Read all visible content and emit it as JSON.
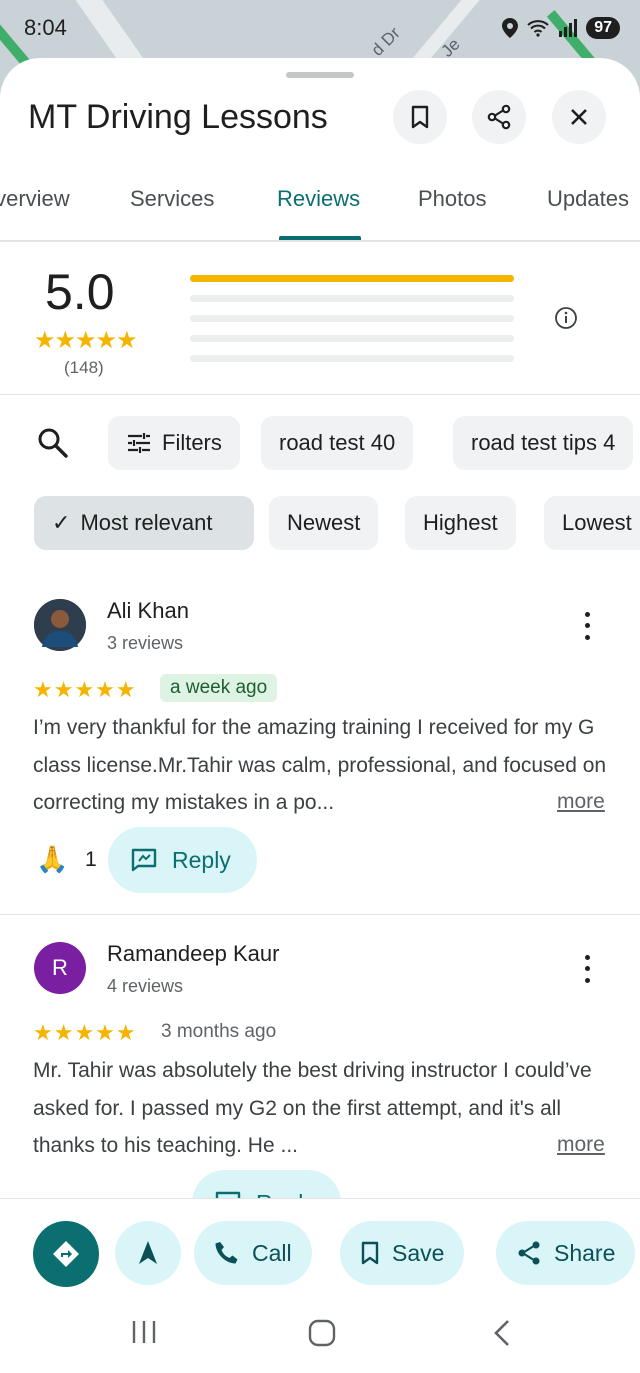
{
  "status_bar": {
    "time": "8:04",
    "battery": "97"
  },
  "map": {
    "labels": [
      "d Dr",
      "Je"
    ]
  },
  "place": {
    "title": "MT Driving Lessons"
  },
  "header_icons": [
    "bookmark-icon",
    "share-icon",
    "close-icon"
  ],
  "tabs": [
    {
      "label": "Overview"
    },
    {
      "label": "Services"
    },
    {
      "label": "Reviews",
      "active": true
    },
    {
      "label": "Photos"
    },
    {
      "label": "Updates"
    }
  ],
  "summary": {
    "rating": "5.0",
    "stars": "★★★★★",
    "count": "(148)",
    "distribution": [
      1.0,
      0.0,
      0.0,
      0.0,
      0.0
    ]
  },
  "filters": {
    "chips": [
      "Filters",
      "road test 40",
      "road test tips 4"
    ]
  },
  "sort": {
    "options": [
      "Most relevant",
      "Newest",
      "Highest",
      "Lowest"
    ],
    "selected": "Most relevant",
    "check": "✓"
  },
  "reviews": [
    {
      "name": "Ali Khan",
      "review_count": "3 reviews",
      "stars": "★★★★★",
      "time": "a week ago",
      "text": "I’m very thankful for the amazing training I received for my G class license.Mr.Tahir was calm, professional, and focused on correcting my mistakes in a po...",
      "more": "more",
      "reaction": "🙏",
      "reaction_count": "1",
      "reply": "Reply"
    },
    {
      "name": "Ramandeep Kaur",
      "initial": "R",
      "review_count": "4 reviews",
      "stars": "★★★★★",
      "time": "3 months ago",
      "text": "Mr. Tahir was absolutely the best driving instructor I could’ve asked for. I passed my G2 on the first attempt, and it's all thanks to his teaching. He ...",
      "more": "more",
      "reply": "Reply"
    }
  ],
  "actions": [
    {
      "label": "",
      "icon": "directions-icon"
    },
    {
      "label": "",
      "icon": "navigate-icon"
    },
    {
      "label": "Call",
      "icon": "phone-icon"
    },
    {
      "label": "Save",
      "icon": "bookmark-icon"
    },
    {
      "label": "Share",
      "icon": "share-icon"
    }
  ],
  "colors": {
    "accent": "#0b6f71",
    "star": "#f4b400",
    "chip_bg": "#f0f2f3",
    "action_bg": "#d9f5f8"
  }
}
